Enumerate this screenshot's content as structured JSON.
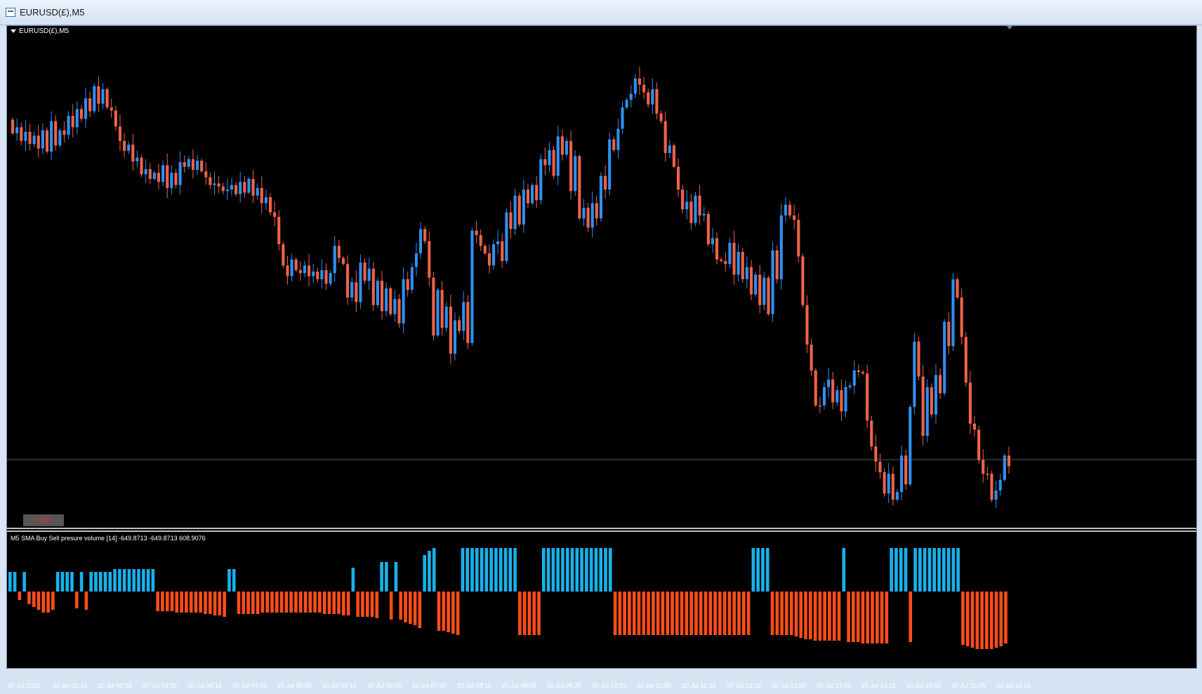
{
  "window": {
    "title": "EURUSD(£),M5"
  },
  "chart": {
    "label": "EURUSD(£),M5",
    "button_label": "FSR"
  },
  "indicator": {
    "label": "M5 SMA Buy Sell presure volume [14] -649.8713 -649.8713 608.9076"
  },
  "colors": {
    "bull": "#2f8ff0",
    "bear": "#f0624a",
    "ind_buy": "#17b2ec",
    "ind_sell": "#ff4d1a",
    "background": "#000000",
    "text": "#ffffff"
  },
  "chart_data": {
    "type": "candlestick",
    "x_axis_labels": [
      "20 Jul 2021",
      "20 Jul 02:15",
      "20 Jul 02:55",
      "20 Jul 03:35",
      "20 Jul 04:15",
      "20 Jul 04:55",
      "20 Jul 05:35",
      "20 Jul 06:15",
      "20 Jul 06:55",
      "20 Jul 07:35",
      "20 Jul 08:15",
      "20 Jul 08:55",
      "20 Jul 09:35",
      "20 Jul 10:15",
      "20 Jul 10:55",
      "20 Jul 11:35",
      "20 Jul 12:15",
      "20 Jul 12:55",
      "20 Jul 13:35",
      "20 Jul 14:15",
      "20 Jul 14:55",
      "20 Jul 15:35",
      "20 Jul 16:15"
    ],
    "price_path": [
      136,
      154,
      146,
      164,
      152,
      168,
      157,
      174,
      150,
      178,
      138,
      170,
      150,
      156,
      131,
      146,
      122,
      135,
      108,
      125,
      92,
      115,
      96,
      120,
      124,
      145,
      164,
      177,
      169,
      191,
      186,
      208,
      201,
      214,
      206,
      218,
      196,
      226,
      206,
      222,
      192,
      198,
      188,
      202,
      190,
      204,
      212,
      222,
      220,
      224,
      230,
      228,
      222,
      234,
      218,
      232,
      214,
      236,
      226,
      246,
      238,
      258,
      264,
      300,
      328,
      342,
      320,
      334,
      338,
      328,
      342,
      336,
      346,
      334,
      352,
      338,
      302,
      318,
      326,
      370,
      350,
      376,
      324,
      348,
      332,
      380,
      348,
      388,
      358,
      392,
      372,
      404,
      346,
      360,
      330,
      312,
      280,
      296,
      344,
      420,
      360,
      410,
      382,
      444,
      400,
      414,
      376,
      430,
      282,
      288,
      302,
      312,
      328,
      300,
      296,
      322,
      258,
      280,
      236,
      274,
      228,
      246,
      222,
      242,
      188,
      196,
      176,
      210,
      158,
      182,
      164,
      230,
      184,
      266,
      252,
      278,
      246,
      266,
      210,
      228,
      162,
      176,
      148,
      120,
      110,
      102,
      82,
      90,
      100,
      116,
      96,
      128,
      138,
      180,
      170,
      198,
      228,
      254,
      244,
      272,
      236,
      262,
      260,
      300,
      292,
      320,
      322,
      326,
      298,
      340,
      310,
      346,
      330,
      366,
      340,
      380,
      344,
      392,
      308,
      346,
      262,
      248,
      262,
      268,
      316,
      380,
      432,
      466,
      512,
      512,
      488,
      478,
      508,
      492,
      520,
      488,
      486,
      466,
      468,
      470,
      532,
      566,
      586,
      600,
      628,
      602,
      636,
      626,
      578,
      616,
      514,
      428,
      474,
      552,
      488,
      524,
      472,
      496,
      402,
      434,
      346,
      370,
      422,
      482,
      536,
      544,
      584,
      602,
      602,
      636,
      624,
      610,
      578,
      592
    ]
  },
  "indicator_data": {
    "type": "bar",
    "values": [
      28,
      28,
      -12,
      28,
      -18,
      -22,
      -26,
      -30,
      -30,
      -26,
      28,
      28,
      28,
      28,
      -24,
      28,
      -26,
      28,
      28,
      28,
      28,
      28,
      32,
      32,
      32,
      32,
      32,
      32,
      32,
      32,
      32,
      -28,
      -28,
      -28,
      -28,
      -30,
      -30,
      -30,
      -30,
      -30,
      -30,
      -32,
      -32,
      -34,
      -34,
      -36,
      32,
      32,
      -32,
      -32,
      -32,
      -32,
      -32,
      -30,
      -30,
      -30,
      -30,
      -30,
      -30,
      -30,
      -30,
      -30,
      -30,
      -30,
      -30,
      -30,
      -32,
      -32,
      -32,
      -32,
      -34,
      -34,
      34,
      -36,
      -36,
      -36,
      -36,
      -38,
      42,
      42,
      -40,
      42,
      -40,
      -44,
      -46,
      -48,
      -52,
      52,
      58,
      62,
      -56,
      -56,
      -58,
      -60,
      -62,
      62,
      62,
      62,
      62,
      62,
      62,
      62,
      62,
      62,
      62,
      62,
      62,
      -62,
      -62,
      -62,
      -62,
      -62,
      62,
      62,
      62,
      62,
      62,
      62,
      62,
      62,
      62,
      62,
      62,
      62,
      62,
      62,
      62,
      -62,
      -62,
      -62,
      -62,
      -62,
      -62,
      -62,
      -62,
      -62,
      -62,
      -62,
      -62,
      -62,
      -62,
      -62,
      -62,
      -62,
      -62,
      -62,
      -62,
      -62,
      -62,
      -62,
      -62,
      -62,
      -62,
      -62,
      -62,
      -62,
      62,
      62,
      62,
      62,
      -62,
      -62,
      -62,
      -62,
      -62,
      -64,
      -66,
      -68,
      -68,
      -70,
      -70,
      -70,
      -70,
      -70,
      -70,
      62,
      -72,
      -72,
      -72,
      -74,
      -74,
      -74,
      -74,
      -74,
      -74,
      62,
      62,
      62,
      62,
      -72,
      62,
      62,
      62,
      62,
      62,
      62,
      62,
      62,
      62,
      62,
      -76,
      -78,
      -80,
      -82,
      -82,
      -82,
      -82,
      -80,
      -78,
      -74
    ],
    "ylim": [
      -80,
      64
    ]
  }
}
